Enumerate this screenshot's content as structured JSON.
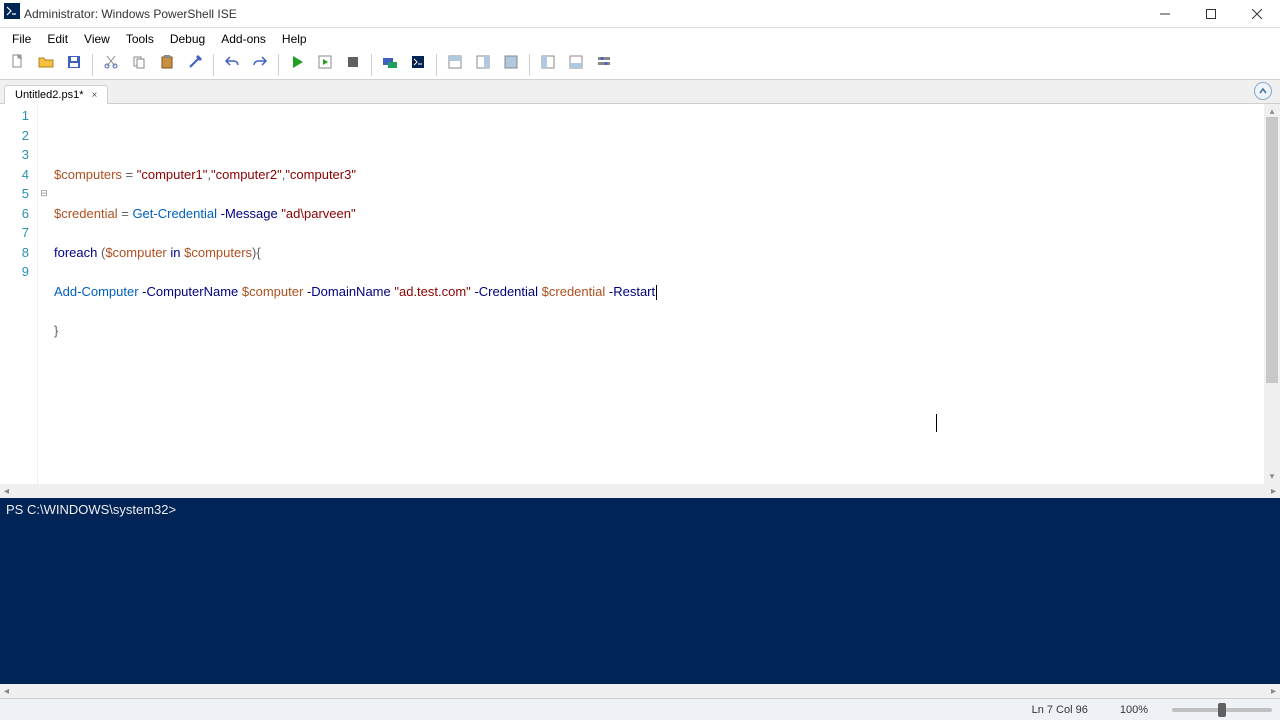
{
  "window": {
    "title": "Administrator: Windows PowerShell ISE"
  },
  "menu": [
    "File",
    "Edit",
    "View",
    "Tools",
    "Debug",
    "Add-ons",
    "Help"
  ],
  "toolbar_icons": [
    "new-file",
    "open-file",
    "save",
    "cut",
    "copy",
    "paste",
    "clear",
    "undo",
    "redo",
    "run-script",
    "run-selection",
    "stop",
    "remote",
    "start-powershell",
    "show-script-pane-top",
    "show-script-pane-right",
    "show-script-pane-maximized",
    "show-command-addon",
    "show-command-window",
    "options"
  ],
  "tab": {
    "name": "Untitled2.ps1*",
    "close": "×"
  },
  "code": {
    "lines": [
      {
        "n": 1,
        "tokens": [
          [
            "var",
            "$computers"
          ],
          [
            "op",
            " = "
          ],
          [
            "str",
            "\"computer1\""
          ],
          [
            "op",
            ","
          ],
          [
            "str",
            "\"computer2\""
          ],
          [
            "op",
            ","
          ],
          [
            "str",
            "\"computer3\""
          ]
        ]
      },
      {
        "n": 2,
        "tokens": []
      },
      {
        "n": 3,
        "tokens": [
          [
            "var",
            "$credential"
          ],
          [
            "op",
            " = "
          ],
          [
            "cmd",
            "Get-Credential"
          ],
          [
            "op",
            " "
          ],
          [
            "param",
            "-Message"
          ],
          [
            "op",
            " "
          ],
          [
            "str",
            "\"ad\\parveen\""
          ]
        ]
      },
      {
        "n": 4,
        "tokens": []
      },
      {
        "n": 5,
        "fold": "⊟",
        "tokens": [
          [
            "kw",
            "foreach"
          ],
          [
            "op",
            " ("
          ],
          [
            "var",
            "$computer"
          ],
          [
            "op",
            " "
          ],
          [
            "kw",
            "in"
          ],
          [
            "op",
            " "
          ],
          [
            "var",
            "$computers"
          ],
          [
            "op",
            "){"
          ]
        ]
      },
      {
        "n": 6,
        "tokens": []
      },
      {
        "n": 7,
        "tokens": [
          [
            "cmd",
            "Add-Computer"
          ],
          [
            "op",
            " "
          ],
          [
            "param",
            "-ComputerName"
          ],
          [
            "op",
            " "
          ],
          [
            "var",
            "$computer"
          ],
          [
            "op",
            " "
          ],
          [
            "param",
            "-DomainName"
          ],
          [
            "op",
            " "
          ],
          [
            "str",
            "\"ad.test.com\""
          ],
          [
            "op",
            " "
          ],
          [
            "param",
            "-Credential"
          ],
          [
            "op",
            " "
          ],
          [
            "var",
            "$credential"
          ],
          [
            "op",
            " "
          ],
          [
            "param",
            "-Restart"
          ]
        ],
        "caret": true
      },
      {
        "n": 8,
        "tokens": []
      },
      {
        "n": 9,
        "tokens": [
          [
            "op",
            "}"
          ]
        ]
      }
    ]
  },
  "console": {
    "prompt": "PS C:\\WINDOWS\\system32>"
  },
  "status": {
    "position": "Ln 7  Col 96",
    "zoom": "100%"
  }
}
